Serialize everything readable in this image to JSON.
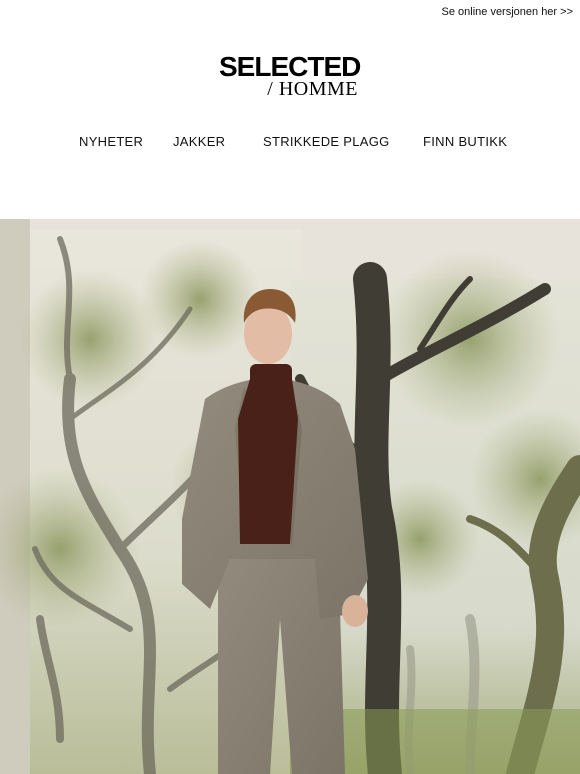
{
  "header": {
    "online_version_link": "Se online versjonen her >>"
  },
  "logo": {
    "brand": "SELECTED",
    "sub": "/ HOMME"
  },
  "nav": {
    "items": [
      {
        "label": "NYHETER"
      },
      {
        "label": "JAKKER"
      },
      {
        "label": "STRIKKEDE PLAGG"
      },
      {
        "label": "FINN BUTIKK"
      }
    ]
  },
  "colors": {
    "background": "#ffffff",
    "text": "#111111",
    "hero_backdrop": "#e6e1d8",
    "forest_green": "#9aa57a",
    "suit_grey": "#8a8275",
    "turtleneck": "#4a2119"
  }
}
